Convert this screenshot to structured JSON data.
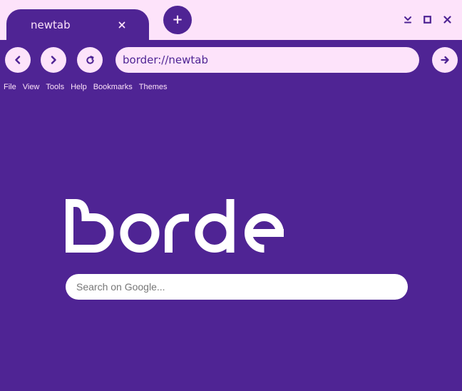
{
  "colors": {
    "chrome": "#fde3fa",
    "accent": "#4f2494"
  },
  "tabs": [
    {
      "title": "newtab",
      "close_icon": "close-icon",
      "active": true
    }
  ],
  "new_tab": {
    "label": "+",
    "icon": "plus-icon"
  },
  "window_controls": [
    {
      "name": "minimize",
      "icon": "minimize-chevron-icon"
    },
    {
      "name": "maximize",
      "icon": "maximize-square-icon"
    },
    {
      "name": "close",
      "icon": "close-icon"
    }
  ],
  "navigation": {
    "back_icon": "chevron-left-icon",
    "forward_icon": "chevron-right-icon",
    "reload_icon": "reload-icon",
    "go_icon": "arrow-right-icon"
  },
  "address_bar": {
    "value": "border://newtab"
  },
  "menu": [
    "File",
    "View",
    "Tools",
    "Help",
    "Bookmarks",
    "Themes"
  ],
  "logo": {
    "text": "Border"
  },
  "search": {
    "placeholder": "Search on Google..."
  }
}
